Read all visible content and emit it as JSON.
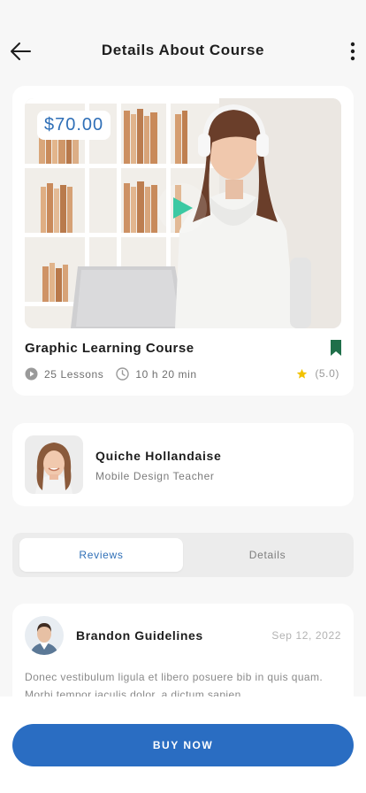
{
  "header": {
    "title": "Details About Course",
    "back_icon": "arrow-left-icon",
    "more_icon": "more-vertical-icon"
  },
  "course": {
    "price": "$70.00",
    "name": "Graphic Learning Course",
    "lessons": "25 Lessons",
    "duration": "10 h 20 min",
    "rating": "(5.0)",
    "bookmark_icon": "bookmark-icon",
    "play_icon": "play-icon"
  },
  "teacher": {
    "name": "Quiche Hollandaise",
    "role": "Mobile Design Teacher"
  },
  "tabs": [
    {
      "label": "Reviews",
      "active": true
    },
    {
      "label": "Details",
      "active": false
    }
  ],
  "review": {
    "name": "Brandon Guidelines",
    "date": "Sep 12, 2022",
    "text": "Donec vestibulum ligula et libero posuere bib in quis quam. Morbi tempor iaculis dolor, a dictum sapien"
  },
  "cta": {
    "label": "BUY NOW"
  },
  "colors": {
    "accent": "#2a6dc2",
    "price_text": "#2f6fb7",
    "play": "#3cc9a3",
    "bookmark": "#1f6f4a",
    "star": "#f2c200"
  }
}
